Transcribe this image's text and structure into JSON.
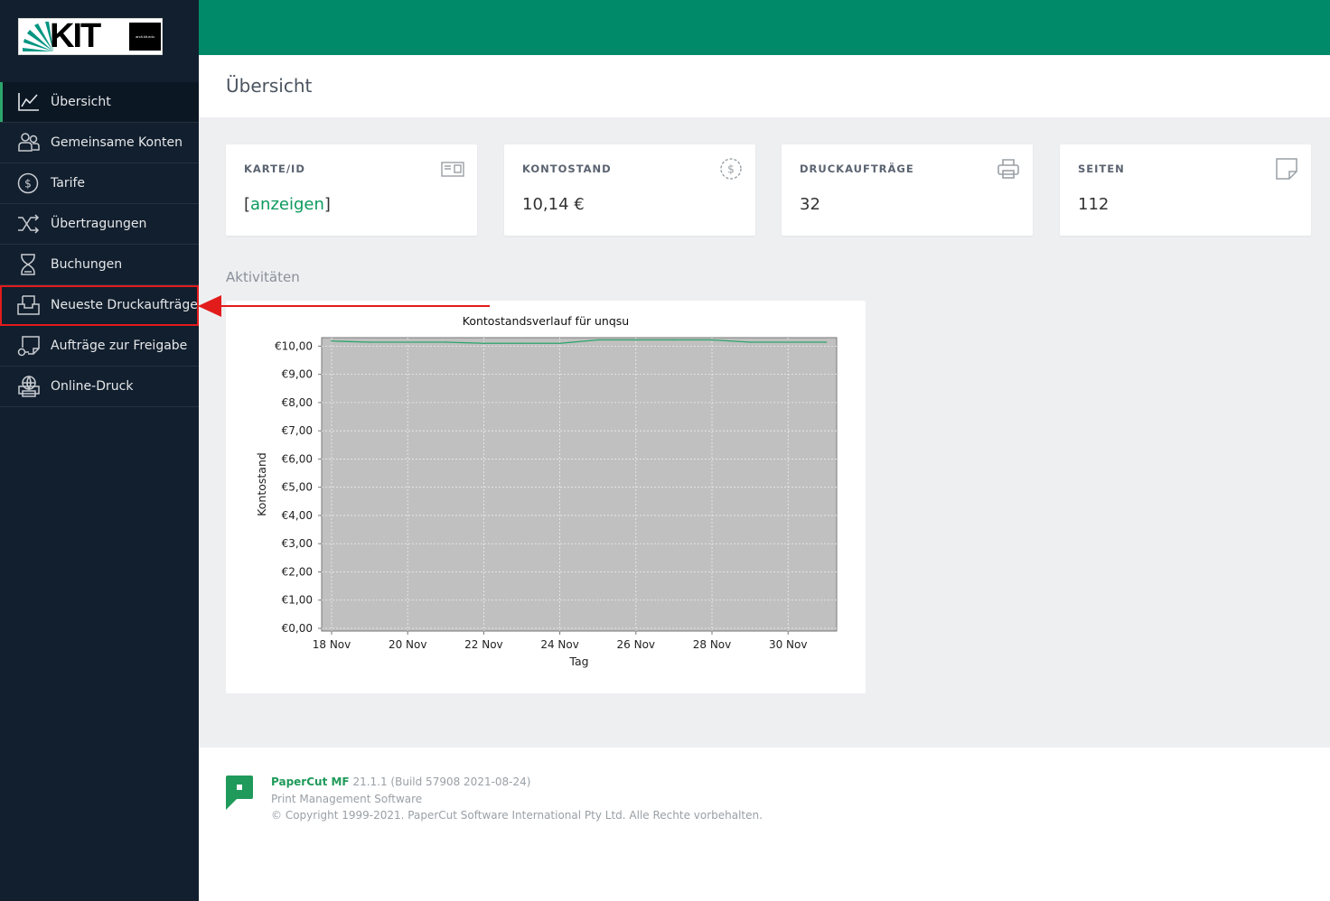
{
  "logo": {
    "text": "KIT",
    "box_text": "arch.kit.edu"
  },
  "sidebar": {
    "items": [
      {
        "label": "Übersicht",
        "icon": "line-chart-icon",
        "active": true
      },
      {
        "label": "Gemeinsame Konten",
        "icon": "users-icon"
      },
      {
        "label": "Tarife",
        "icon": "dollar-circle-icon"
      },
      {
        "label": "Übertragungen",
        "icon": "shuffle-icon"
      },
      {
        "label": "Buchungen",
        "icon": "hourglass-icon"
      },
      {
        "label": "Neueste Druckaufträge",
        "icon": "inbox-tray-icon",
        "highlighted": true
      },
      {
        "label": "Aufträge zur Freigabe",
        "icon": "release-job-icon"
      },
      {
        "label": "Online-Druck",
        "icon": "web-print-icon"
      }
    ]
  },
  "header": {
    "title": "Übersicht"
  },
  "cards": [
    {
      "label": "KARTE/ID",
      "value_prefix": "[",
      "value_link": "anzeigen",
      "value_suffix": "]",
      "icon": "id-card-icon"
    },
    {
      "label": "KONTOSTAND",
      "value": "10,14 €",
      "icon": "dollar-circle-icon"
    },
    {
      "label": "DRUCKAUFTRÄGE",
      "value": "32",
      "icon": "printer-icon"
    },
    {
      "label": "SEITEN",
      "value": "112",
      "icon": "page-icon"
    }
  ],
  "activities": {
    "title": "Aktivitäten"
  },
  "chart_data": {
    "type": "line",
    "title": "Kontostandsverlauf für unqsu",
    "xlabel": "Tag",
    "ylabel": "Kontostand",
    "x_ticks": [
      "18 Nov",
      "20 Nov",
      "22 Nov",
      "24 Nov",
      "26 Nov",
      "28 Nov",
      "30 Nov"
    ],
    "y_ticks": [
      "€0,00",
      "€1,00",
      "€2,00",
      "€3,00",
      "€4,00",
      "€5,00",
      "€6,00",
      "€7,00",
      "€8,00",
      "€9,00",
      "€10,00"
    ],
    "ylim": [
      0,
      10.3
    ],
    "grid": true,
    "background": "#c0c0c0",
    "line_color": "#2ca56c",
    "series": [
      {
        "x": [
          "18 Nov",
          "19 Nov",
          "20 Nov",
          "21 Nov",
          "22 Nov",
          "23 Nov",
          "24 Nov",
          "25 Nov",
          "26 Nov",
          "27 Nov",
          "28 Nov",
          "29 Nov",
          "30 Nov",
          "1 Dec"
        ],
        "values": [
          10.18,
          10.14,
          10.14,
          10.14,
          10.1,
          10.1,
          10.1,
          10.22,
          10.22,
          10.22,
          10.22,
          10.14,
          10.14,
          10.14
        ]
      }
    ]
  },
  "footer": {
    "brand": "PaperCut MF",
    "version": "21.1.1 (Build 57908 2021-08-24)",
    "subtitle": "Print Management Software",
    "copyright": "© Copyright 1999-2021. PaperCut Software International Pty Ltd. Alle Rechte vorbehalten."
  },
  "colors": {
    "topbar": "#008a6a",
    "sidebar": "#121f2e",
    "accent": "#0c9a5d",
    "highlight": "#e21b1b"
  }
}
